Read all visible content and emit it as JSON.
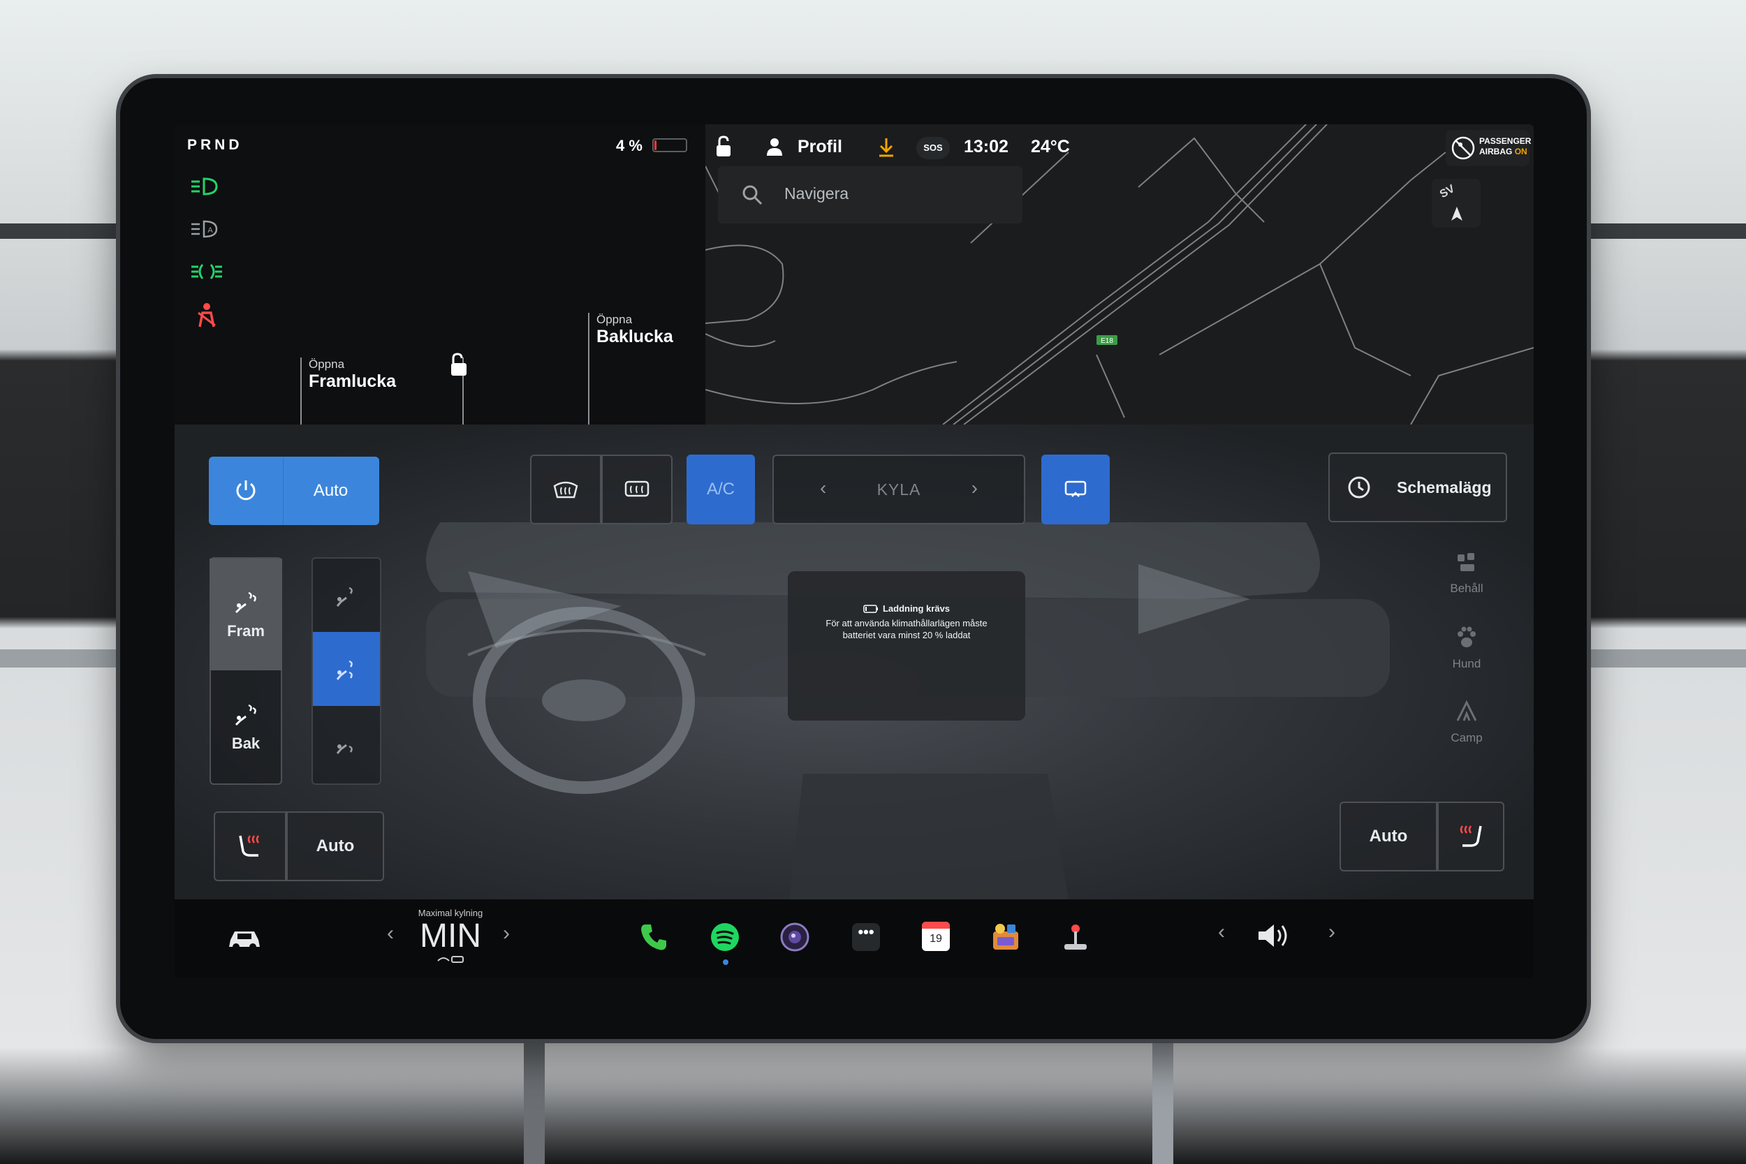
{
  "status_bar": {
    "gear": "PRND",
    "battery_percent": "4 %",
    "battery_fraction": 0.04,
    "profile_label": "Profil",
    "sos_label": "SOS",
    "time": "13:02",
    "temperature": "24°C",
    "airbag_line1": "PASSENGER",
    "airbag_line2": "AIRBAG",
    "airbag_state": "ON"
  },
  "indicators": [
    "headlight-green-icon",
    "auto-headlight-icon",
    "parking-light-green-icon",
    "seatbelt-red-icon"
  ],
  "colors": {
    "accent_blue": "#3b86dc",
    "indicator_green": "#22d36b",
    "warning_red": "#ff4a4a",
    "download_orange": "#f0a500"
  },
  "car_panel": {
    "frunk_small": "Öppna",
    "frunk_big": "Framlucka",
    "trunk_small": "Öppna",
    "trunk_big": "Baklucka"
  },
  "map": {
    "search_placeholder": "Navigera",
    "compass": "SV",
    "road_label": "E18"
  },
  "climate": {
    "power_auto_label": "Auto",
    "ac_label": "A/C",
    "mode_label": "KYLA",
    "schedule_label": "Schemalägg",
    "front_label": "Fram",
    "rear_label": "Bak",
    "seat_left_auto": "Auto",
    "seat_right_auto": "Auto",
    "modes": [
      "Behåll",
      "Hund",
      "Camp"
    ]
  },
  "message": {
    "title": "Laddning krävs",
    "line1": "För att använda klimathållarlägen måste",
    "line2": "batteriet vara minst 20 % laddat"
  },
  "dock": {
    "fan_caption": "Maximal kylning",
    "fan_value": "MIN",
    "calendar_day": "19"
  }
}
